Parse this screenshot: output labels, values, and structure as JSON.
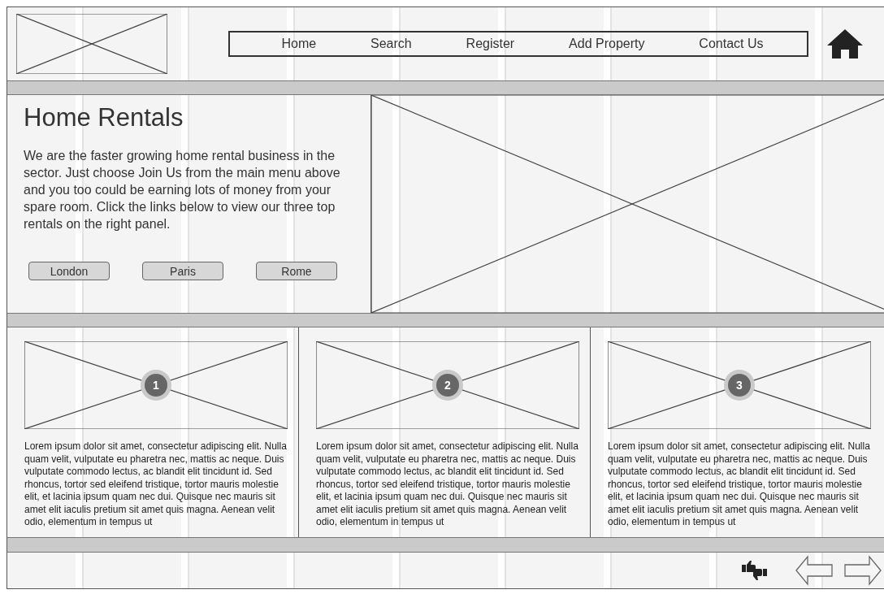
{
  "nav": {
    "items": [
      {
        "label": "Home"
      },
      {
        "label": "Search"
      },
      {
        "label": "Register"
      },
      {
        "label": "Add Property"
      },
      {
        "label": "Contact Us"
      }
    ]
  },
  "hero": {
    "title": "Home Rentals",
    "text": "We are the faster growing home rental business in the sector. Just choose Join Us from the main menu above and you too could be earning lots of money from your spare room. Click the links below to view our three top rentals on the right panel.",
    "buttons": [
      {
        "label": "London"
      },
      {
        "label": "Paris"
      },
      {
        "label": "Rome"
      }
    ]
  },
  "cards": [
    {
      "badge": "1",
      "text": "Lorem ipsum dolor sit amet, consectetur adipiscing elit. Nulla quam velit, vulputate eu pharetra nec, mattis ac neque. Duis vulputate commodo lectus, ac blandit elit tincidunt id. Sed rhoncus, tortor sed eleifend tristique, tortor mauris molestie elit, et lacinia ipsum quam nec dui. Quisque nec mauris sit amet elit iaculis pretium sit amet quis magna. Aenean velit odio, elementum in tempus ut"
    },
    {
      "badge": "2",
      "text": "Lorem ipsum dolor sit amet, consectetur adipiscing elit. Nulla quam velit, vulputate eu pharetra nec, mattis ac neque. Duis vulputate commodo lectus, ac blandit elit tincidunt id. Sed rhoncus, tortor sed eleifend tristique, tortor mauris molestie elit, et lacinia ipsum quam nec dui. Quisque nec mauris sit amet elit iaculis pretium sit amet quis magna. Aenean velit odio, elementum in tempus ut"
    },
    {
      "badge": "3",
      "text": "Lorem ipsum dolor sit amet, consectetur adipiscing elit. Nulla quam velit, vulputate eu pharetra nec, mattis ac neque. Duis vulputate commodo lectus, ac blandit elit tincidunt id. Sed rhoncus, tortor sed eleifend tristique, tortor mauris molestie elit, et lacinia ipsum quam nec dui. Quisque nec mauris sit amet elit iaculis pretium sit amet quis magna. Aenean velit odio, elementum in tempus ut"
    }
  ]
}
